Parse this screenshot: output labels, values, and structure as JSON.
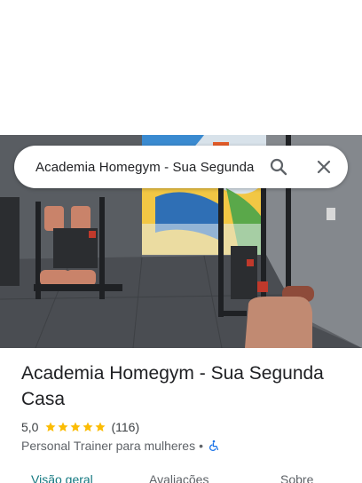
{
  "search": {
    "query": "Academia Homegym - Sua Segunda"
  },
  "place": {
    "title": "Academia Homegym - Sua Segunda Casa",
    "rating": "5,0",
    "stars": 5,
    "review_count": "(116)",
    "category": "Personal Trainer para mulheres",
    "separator": "•",
    "accessibility_icon": "wheelchair-icon"
  },
  "tabs": [
    {
      "label": "Visão geral",
      "active": true
    },
    {
      "label": "Avaliações",
      "active": false
    },
    {
      "label": "Sobre",
      "active": false
    }
  ],
  "colors": {
    "star": "#fbbc04",
    "active_tab": "#137880",
    "accessibility": "#1a73e8",
    "text_secondary": "#5f6368"
  }
}
